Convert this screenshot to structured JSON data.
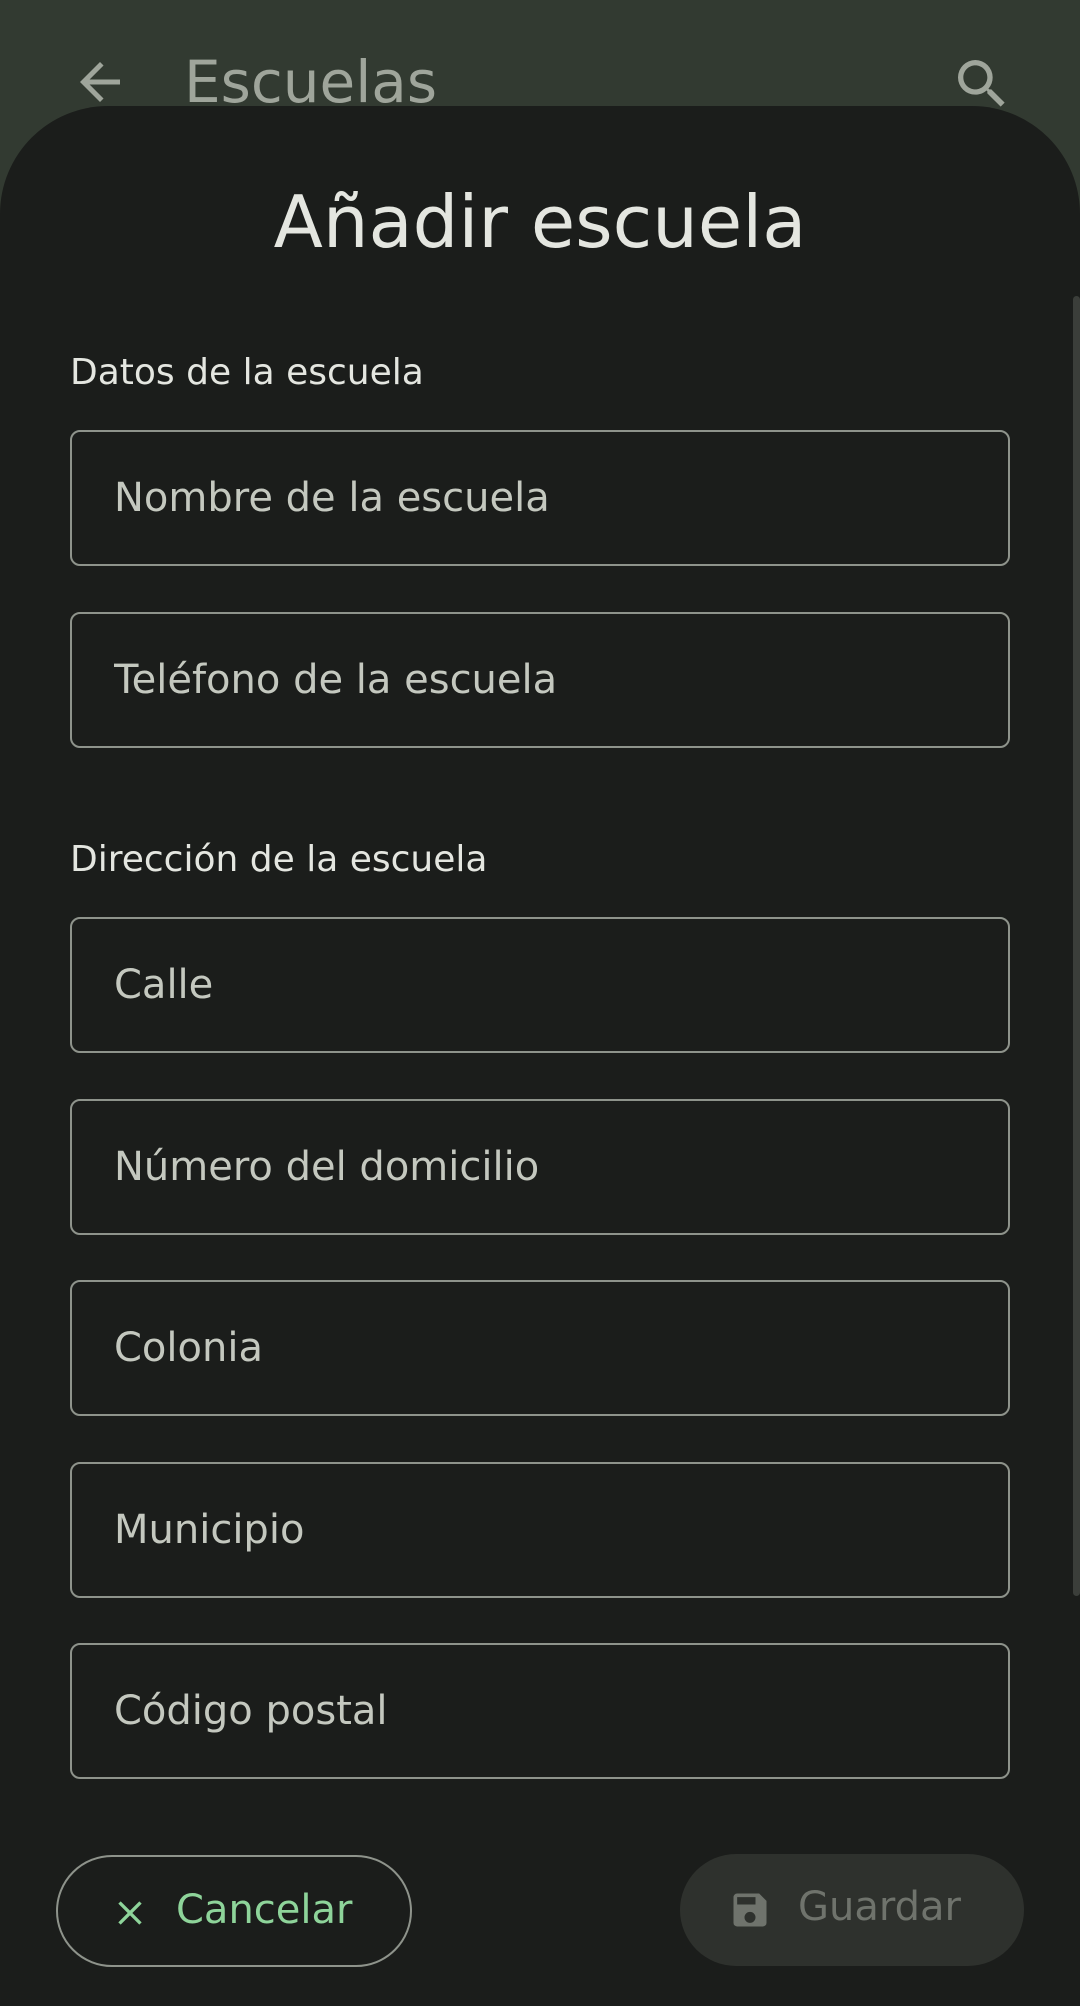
{
  "app_bar": {
    "title": "Escuelas",
    "back_icon": "arrow-back-icon",
    "search_icon": "search-icon"
  },
  "dialog": {
    "title": "Añadir escuela",
    "school_section": {
      "label": "Datos de la escuela",
      "fields": [
        {
          "placeholder": "Nombre de la escuela",
          "value": ""
        },
        {
          "placeholder": "Teléfono de la escuela",
          "value": ""
        }
      ]
    },
    "address_section": {
      "label": "Dirección de la escuela",
      "fields": [
        {
          "placeholder": "Calle",
          "value": ""
        },
        {
          "placeholder": "Número del domicilio",
          "value": ""
        },
        {
          "placeholder": "Colonia",
          "value": ""
        },
        {
          "placeholder": "Municipio",
          "value": ""
        },
        {
          "placeholder": "Código postal",
          "value": ""
        }
      ]
    },
    "cancel_button": {
      "label": "Cancelar",
      "icon": "close-icon"
    },
    "save_button": {
      "label": "Guardar",
      "icon": "save-icon",
      "enabled": false
    }
  },
  "colors": {
    "accent": "#8ed49a",
    "background": "#1b1d1b",
    "app_bar": "#323a31",
    "outline": "#8e938b"
  }
}
